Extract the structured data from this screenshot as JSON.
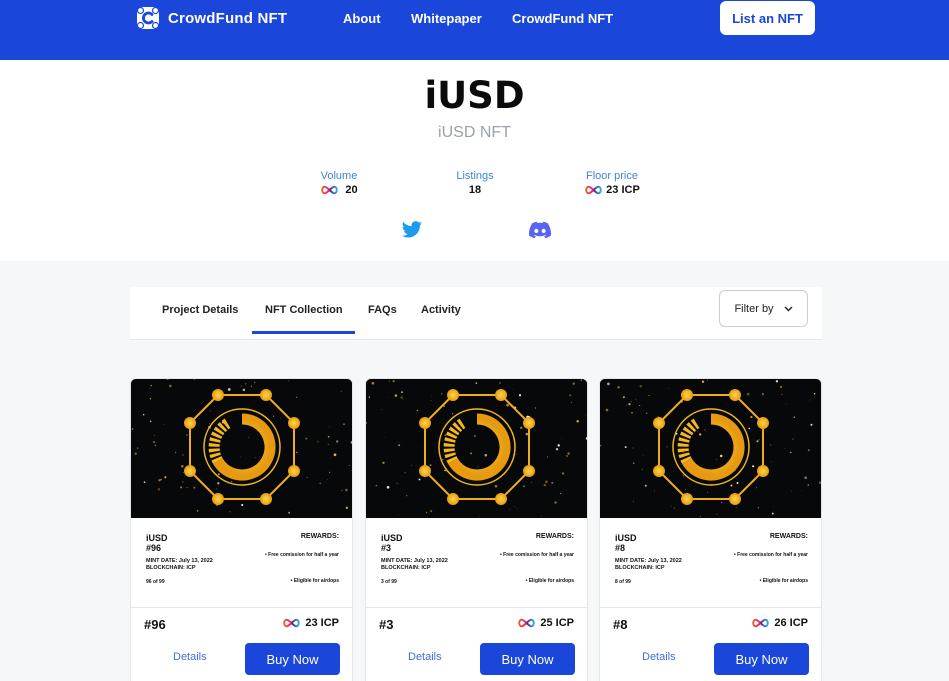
{
  "nav": {
    "brand": "CrowdFund NFT",
    "links": [
      "About",
      "Whitepaper",
      "CrowdFund NFT"
    ],
    "cta": "List an NFT"
  },
  "collection": {
    "title": "iUSD",
    "subtitle": "iUSD NFT",
    "stats": [
      {
        "label": "Volume",
        "value": "20",
        "icon": "icp-infinity-icon"
      },
      {
        "label": "Listings",
        "value": "18"
      },
      {
        "label": "Floor price",
        "value": "23 ICP",
        "icon": "icp-infinity-icon"
      }
    ],
    "socials": [
      "twitter-icon",
      "discord-icon"
    ]
  },
  "tabs": {
    "items": [
      "Project Details",
      "NFT Collection",
      "FAQs",
      "Activity"
    ],
    "active": "NFT Collection",
    "filter_label": "Filter by"
  },
  "cards": [
    {
      "cert_title": "iUSD",
      "cert_number": "#96",
      "mint_date": "MINT DATE: July 13, 2022",
      "blockchain": "BLOCKCHAIN: ICP",
      "edition": "96 of 99",
      "rewards_title": "REWARDS:",
      "reward_1": "• Free comission for half a year",
      "reward_2": "• Eligible for airdops",
      "number": "#96",
      "price": "23 ICP",
      "details": "Details",
      "buy": "Buy Now"
    },
    {
      "cert_title": "iUSD",
      "cert_number": "#3",
      "mint_date": "MINT DATE: July 13, 2022",
      "blockchain": "BLOCKCHAIN: ICP",
      "edition": "3 of 99",
      "rewards_title": "REWARDS:",
      "reward_1": "• Free comission for half a year",
      "reward_2": "• Eligible for airdops",
      "number": "#3",
      "price": "25 ICP",
      "details": "Details",
      "buy": "Buy Now"
    },
    {
      "cert_title": "iUSD",
      "cert_number": "#8",
      "mint_date": "MINT DATE: July 13, 2022",
      "blockchain": "BLOCKCHAIN: ICP",
      "edition": "8 of 99",
      "rewards_title": "REWARDS:",
      "reward_1": "• Free comission for half a year",
      "reward_2": "• Eligible for airdops",
      "number": "#8",
      "price": "26 ICP",
      "details": "Details",
      "buy": "Buy Now"
    }
  ],
  "colors": {
    "primary": "#1a47d9",
    "stat_label": "#3f83d8",
    "subtitle": "#9aa1ab",
    "emblem_gold": "#f5b81c"
  }
}
